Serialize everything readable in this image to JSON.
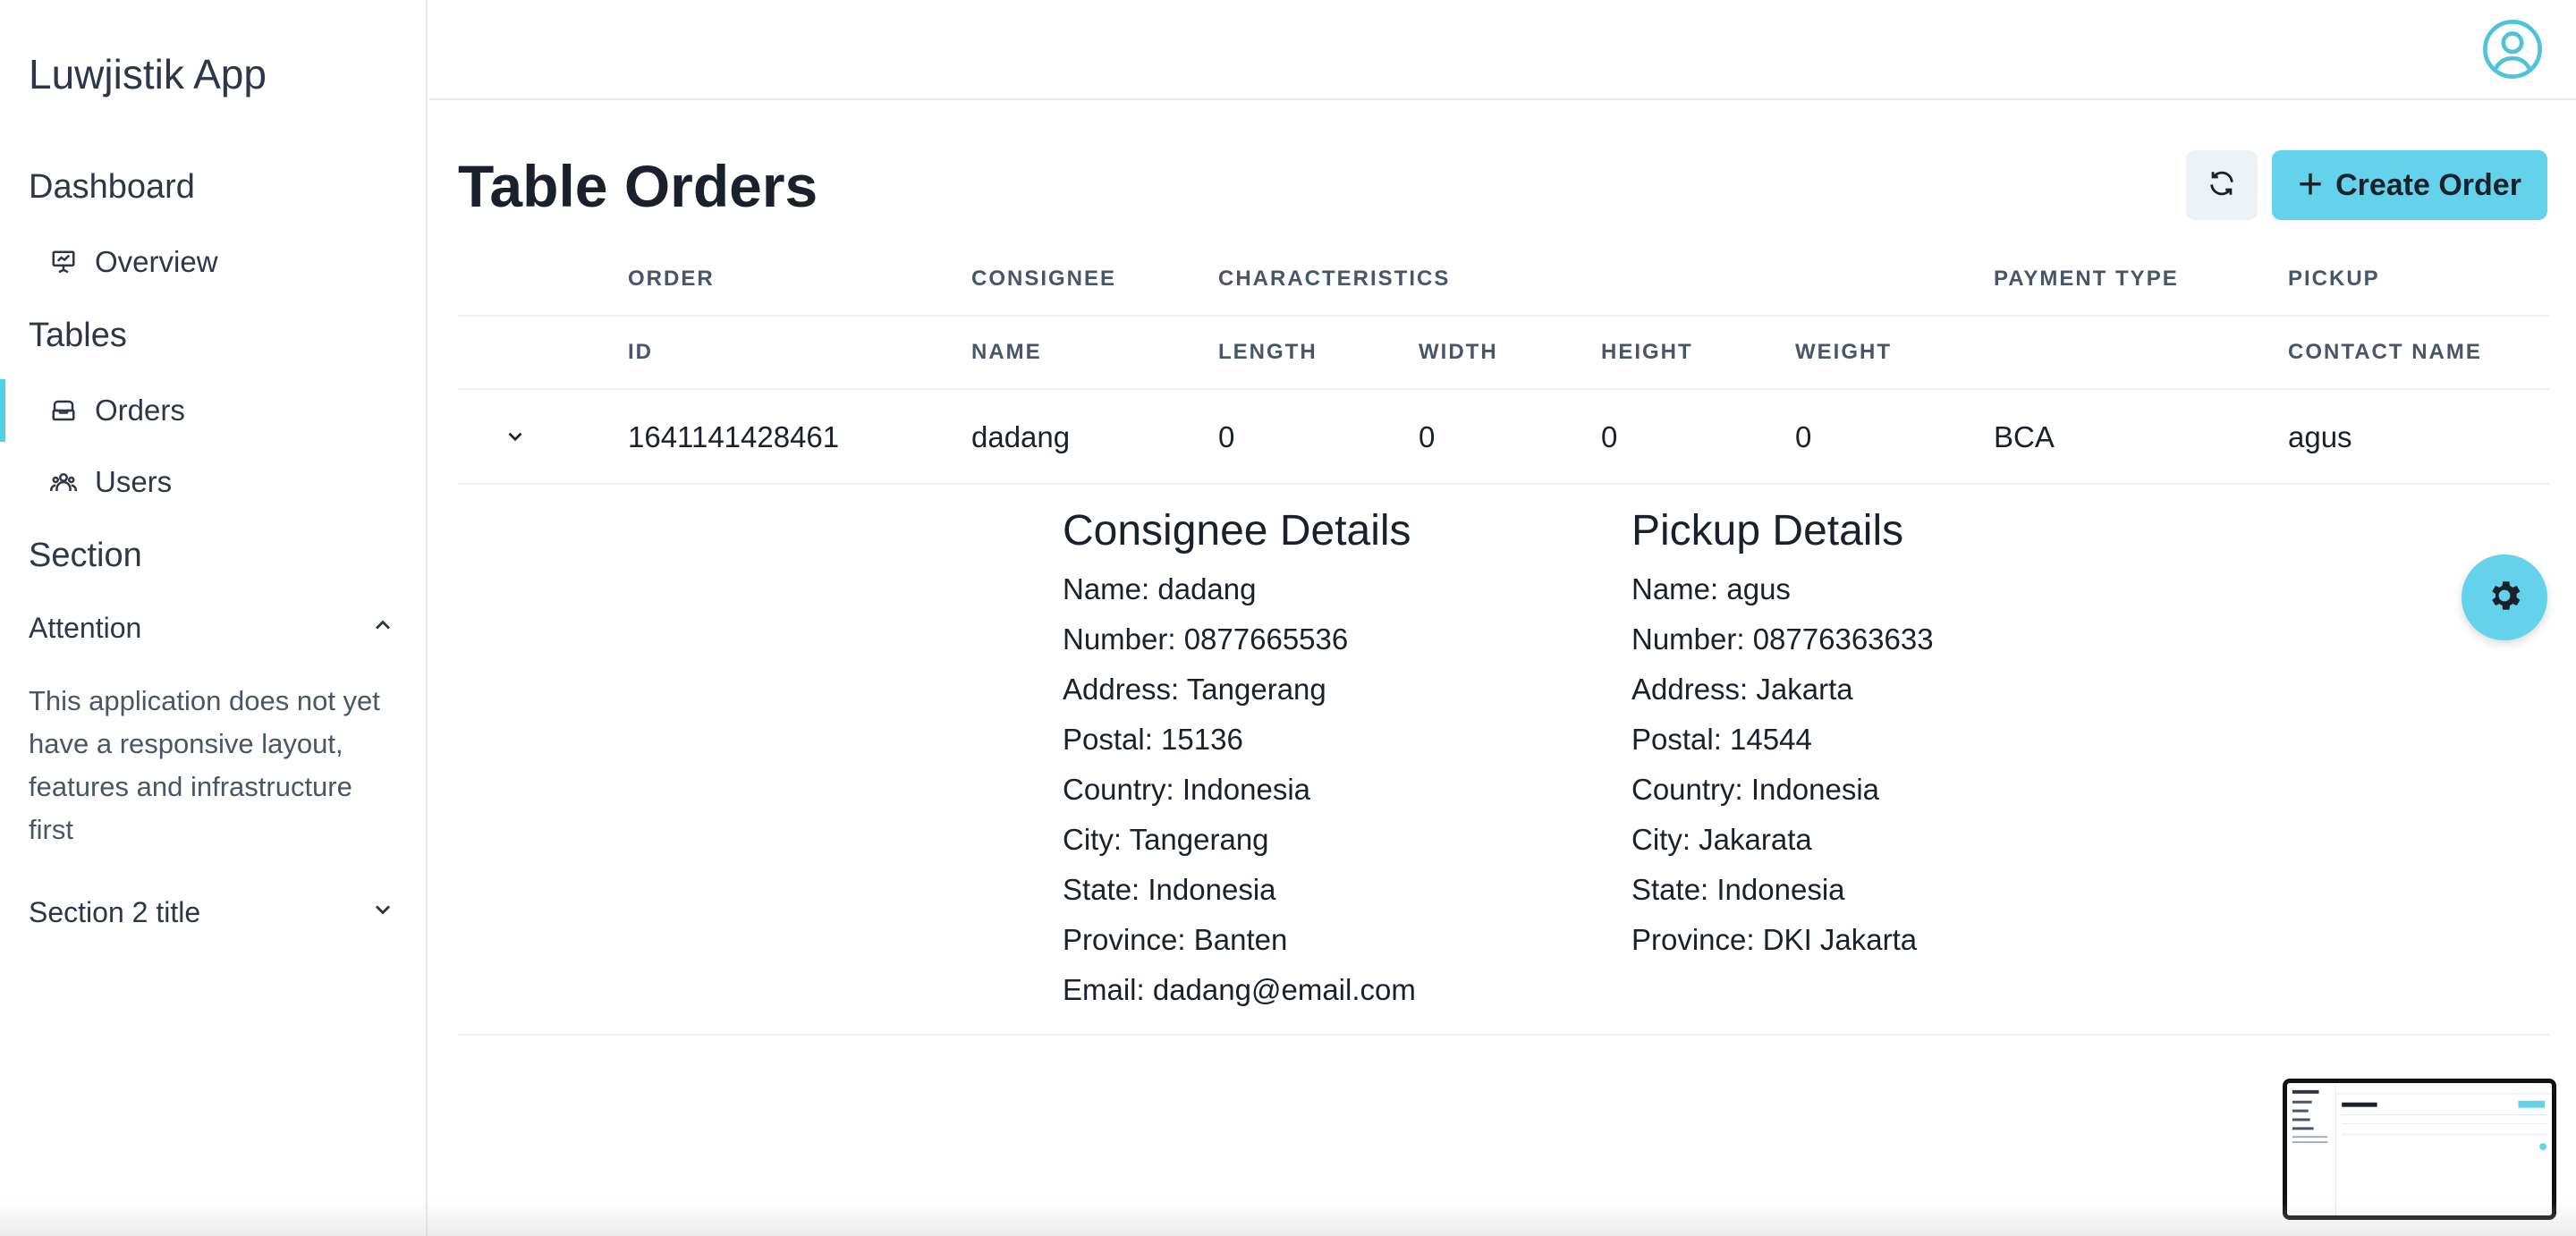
{
  "app": {
    "title": "Luwjistik App"
  },
  "sidebar": {
    "sections": [
      {
        "label": "Dashboard",
        "items": [
          {
            "label": "Overview",
            "icon": "presentation-icon"
          }
        ]
      },
      {
        "label": "Tables",
        "items": [
          {
            "label": "Orders",
            "icon": "inbox-icon",
            "active": true
          },
          {
            "label": "Users",
            "icon": "users-icon"
          }
        ]
      },
      {
        "label": "Section"
      }
    ],
    "accordion": [
      {
        "label": "Attention",
        "expanded": true,
        "body": "This application does not yet have a responsive layout, features and infrastructure first"
      },
      {
        "label": "Section 2 title",
        "expanded": false
      }
    ]
  },
  "header": {
    "avatar_icon": "user-circle-icon"
  },
  "main": {
    "title": "Table Orders",
    "refresh_icon": "refresh-icon",
    "create_label": "Create Order",
    "accent": "#63d2ea"
  },
  "table": {
    "group_headers": [
      "ORDER",
      "CONSIGNEE",
      "CHARACTERISTICS",
      "PAYMENT TYPE",
      "PICKUP"
    ],
    "columns": [
      "ID",
      "NAME",
      "LENGTH",
      "WIDTH",
      "HEIGHT",
      "WEIGHT",
      "",
      "CONTACT NAME"
    ],
    "rows": [
      {
        "cells": [
          "1641141428461",
          "dadang",
          "0",
          "0",
          "0",
          "0",
          "BCA",
          "agus"
        ],
        "expanded": true
      }
    ]
  },
  "details": {
    "consignee": {
      "title": "Consignee Details",
      "lines": [
        "Name: dadang",
        "Number: 0877665536",
        "Address: Tangerang",
        "Postal: 15136",
        "Country: Indonesia",
        "City: Tangerang",
        "State: Indonesia",
        "Province: Banten",
        "Email: dadang@email.com"
      ]
    },
    "pickup": {
      "title": "Pickup Details",
      "lines": [
        "Name: agus",
        "Number: 08776363633",
        "Address: Jakarta",
        "Postal: 14544",
        "Country: Indonesia",
        "City: Jakarata",
        "State: Indonesia",
        "Province: DKI Jakarta"
      ]
    }
  }
}
